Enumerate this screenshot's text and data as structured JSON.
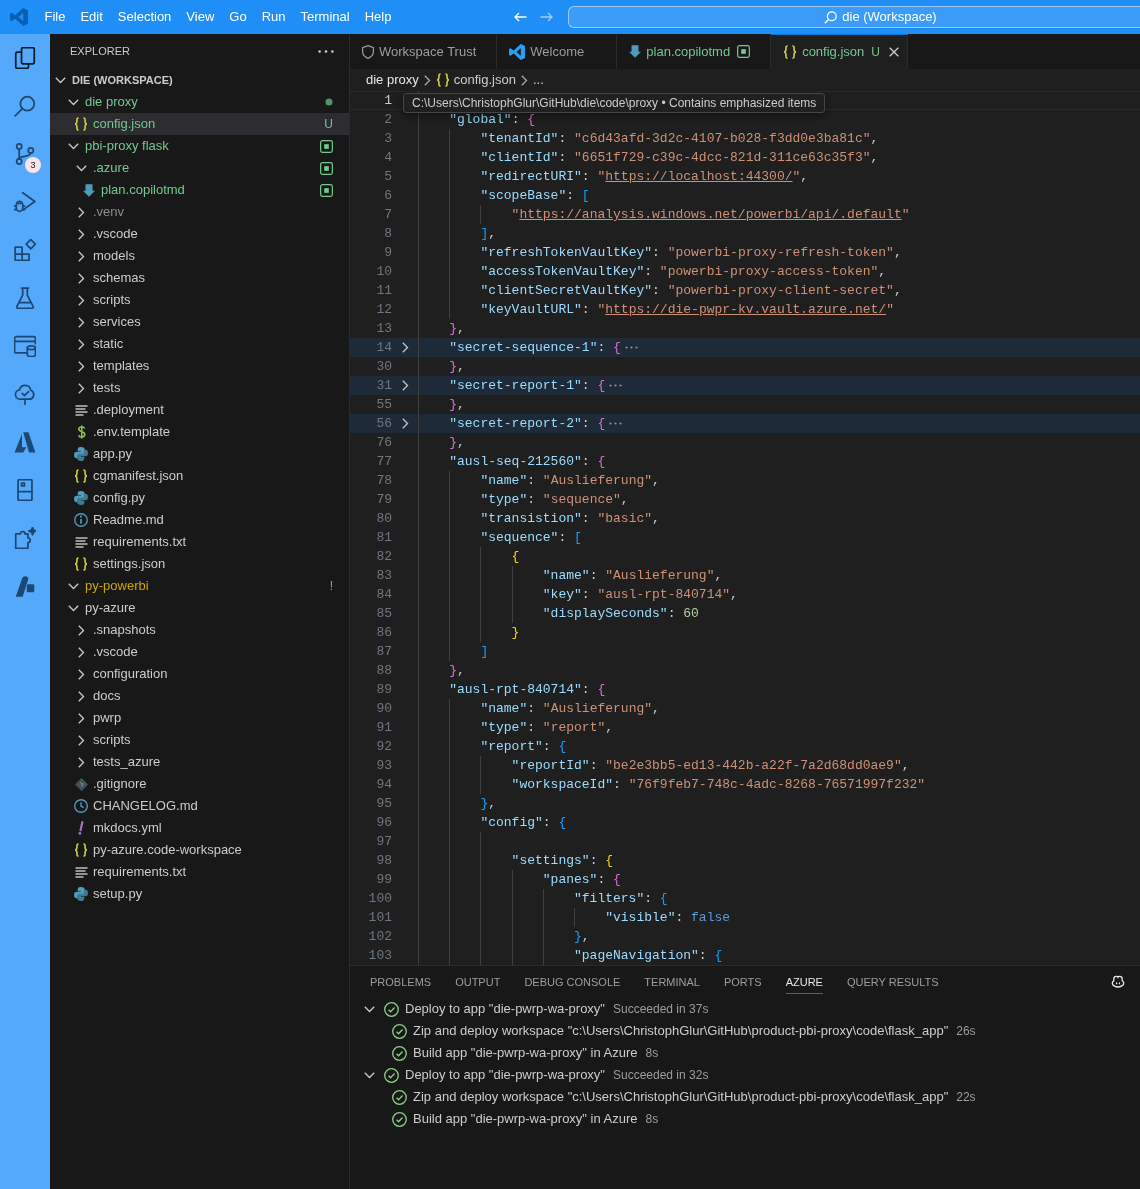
{
  "title_bar": {
    "menus": [
      "File",
      "Edit",
      "Selection",
      "View",
      "Go",
      "Run",
      "Terminal",
      "Help"
    ],
    "navigation": [
      {
        "kind": "back",
        "disabled": false
      },
      {
        "kind": "forward",
        "disabled": true
      }
    ],
    "search": "die (Workspace)"
  },
  "activity_bar": [
    {
      "kind": "files",
      "selected": true
    },
    {
      "kind": "search",
      "selected": false
    },
    {
      "kind": "branch",
      "selected": false,
      "badge": "3"
    },
    {
      "kind": "debug",
      "selected": false
    },
    {
      "kind": "extensions",
      "selected": false
    },
    {
      "kind": "flask",
      "selected": false
    },
    {
      "kind": "database",
      "selected": false
    },
    {
      "kind": "tree",
      "selected": false
    },
    {
      "kind": "triangle",
      "selected": false
    },
    {
      "kind": "panel",
      "selected": false
    },
    {
      "kind": "puzzle",
      "selected": false
    },
    {
      "kind": "blade",
      "selected": false
    }
  ],
  "explorer": {
    "title": "EXPLORER",
    "root": {
      "label": "DIE (WORKSPACE)",
      "expanded": true,
      "children": [
        {
          "label": "die proxy",
          "kind": "folder",
          "expanded": true,
          "selected": false,
          "color": "#73c991",
          "decoration": {
            "kind": "dot"
          },
          "children": [
            {
              "label": "config.json",
              "kind": "json",
              "selected": true,
              "color": "#73c991",
              "decoration": {
                "kind": "letter",
                "text": "U"
              }
            }
          ]
        },
        {
          "label": "pbi-proxy flask",
          "kind": "folder",
          "expanded": true,
          "selected": false,
          "color": "#73c991",
          "decoration": {
            "kind": "square"
          },
          "children": [
            {
              "label": ".azure",
              "kind": "folder",
              "expanded": true,
              "selected": false,
              "color": "#73c991",
              "decoration": {
                "kind": "square"
              },
              "children": [
                {
                  "label": "plan.copilotmd",
                  "kind": "copilot",
                  "selected": false,
                  "color": "#73c991",
                  "decoration": {
                    "kind": "square"
                  }
                }
              ]
            },
            {
              "label": ".venv",
              "kind": "folder",
              "expanded": false,
              "selected": false,
              "color": "#8c8c8c"
            },
            {
              "label": ".vscode",
              "kind": "folder",
              "expanded": false,
              "selected": false
            },
            {
              "label": "models",
              "kind": "folder",
              "expanded": false,
              "selected": false
            },
            {
              "label": "schemas",
              "kind": "folder",
              "expanded": false,
              "selected": false
            },
            {
              "label": "scripts",
              "kind": "folder",
              "expanded": false,
              "selected": false
            },
            {
              "label": "services",
              "kind": "folder",
              "expanded": false,
              "selected": false
            },
            {
              "label": "static",
              "kind": "folder",
              "expanded": false,
              "selected": false
            },
            {
              "label": "templates",
              "kind": "folder",
              "expanded": false,
              "selected": false
            },
            {
              "label": "tests",
              "kind": "folder",
              "expanded": false,
              "selected": false
            },
            {
              "label": ".deployment",
              "kind": "text",
              "selected": false
            },
            {
              "label": ".env.template",
              "kind": "env",
              "selected": false
            },
            {
              "label": "app.py",
              "kind": "python",
              "selected": false
            },
            {
              "label": "cgmanifest.json",
              "kind": "json",
              "selected": false
            },
            {
              "label": "config.py",
              "kind": "python",
              "selected": false
            },
            {
              "label": "Readme.md",
              "kind": "info",
              "selected": false
            },
            {
              "label": "requirements.txt",
              "kind": "text",
              "selected": false
            },
            {
              "label": "settings.json",
              "kind": "json",
              "selected": false
            }
          ]
        },
        {
          "label": "py-powerbi",
          "kind": "folder",
          "expanded": true,
          "selected": false,
          "color": "#cca700",
          "decoration": {
            "kind": "letter",
            "text": "!"
          }
        },
        {
          "label": "py-azure",
          "kind": "folder",
          "expanded": true,
          "selected": false,
          "children": [
            {
              "label": ".snapshots",
              "kind": "folder",
              "expanded": false,
              "selected": false
            },
            {
              "label": ".vscode",
              "kind": "folder",
              "expanded": false,
              "selected": false
            },
            {
              "label": "configuration",
              "kind": "folder",
              "expanded": false,
              "selected": false
            },
            {
              "label": "docs",
              "kind": "folder",
              "expanded": false,
              "selected": false
            },
            {
              "label": "pwrp",
              "kind": "folder",
              "expanded": false,
              "selected": false
            },
            {
              "label": "scripts",
              "kind": "folder",
              "expanded": false,
              "selected": false
            },
            {
              "label": "tests_azure",
              "kind": "folder",
              "expanded": false,
              "selected": false
            },
            {
              "label": ".gitignore",
              "kind": "git",
              "selected": false
            },
            {
              "label": "CHANGELOG.md",
              "kind": "changelog",
              "selected": false
            },
            {
              "label": "mkdocs.yml",
              "kind": "yaml",
              "selected": false
            },
            {
              "label": "py-azure.code-workspace",
              "kind": "json",
              "selected": false
            },
            {
              "label": "requirements.txt",
              "kind": "text",
              "selected": false
            },
            {
              "label": "setup.py",
              "kind": "python",
              "selected": false
            }
          ]
        }
      ]
    }
  },
  "tabs": [
    {
      "label": "Workspace Trust",
      "kind": "trust",
      "selected": false
    },
    {
      "label": "Welcome",
      "kind": "welcome",
      "selected": false
    },
    {
      "label": "plan.copilotmd",
      "kind": "copilot",
      "selected": false,
      "color": "#73c991",
      "decoration": {
        "kind": "square"
      }
    },
    {
      "label": "config.json",
      "kind": "json",
      "selected": true,
      "color": "#73c991",
      "decoration": {
        "kind": "letter",
        "text": "U"
      }
    }
  ],
  "breadcrumb": [
    {
      "label": "die proxy",
      "kind": "folder"
    },
    {
      "label": "config.json",
      "kind": "json"
    },
    {
      "label": "...",
      "kind": "symbols"
    }
  ],
  "tooltip": "C:\\Users\\ChristophGlur\\GitHub\\die\\code\\proxy • Contains emphasized items",
  "code_lines": [
    {
      "number": "1",
      "current": true,
      "folded": false
    },
    {
      "number": "2",
      "current": false,
      "folded": false,
      "text": "    \"global\": {"
    },
    {
      "number": "3",
      "current": false,
      "folded": false,
      "text": "        \"tenantId\": \"c6d43afd-3d2c-4107-b028-f3dd0e3ba81c\","
    },
    {
      "number": "4",
      "current": false,
      "folded": false,
      "text": "        \"clientId\": \"6651f729-c39c-4dcc-821d-311ce63c35f3\","
    },
    {
      "number": "5",
      "current": false,
      "folded": false,
      "text": "        \"redirectURI\": \"https://localhost:44300/\","
    },
    {
      "number": "6",
      "current": false,
      "folded": false,
      "text": "        \"scopeBase\": ["
    },
    {
      "number": "7",
      "current": false,
      "folded": false,
      "text": "            \"https://analysis.windows.net/powerbi/api/.default\""
    },
    {
      "number": "8",
      "current": false,
      "folded": false,
      "text": "        ],"
    },
    {
      "number": "9",
      "current": false,
      "folded": false,
      "text": "        \"refreshTokenVaultKey\": \"powerbi-proxy-refresh-token\","
    },
    {
      "number": "10",
      "current": false,
      "folded": false,
      "text": "        \"accessTokenVaultKey\": \"powerbi-proxy-access-token\","
    },
    {
      "number": "11",
      "current": false,
      "folded": false,
      "text": "        \"clientSecretVaultKey\": \"powerbi-proxy-client-secret\","
    },
    {
      "number": "12",
      "current": false,
      "folded": false,
      "text": "        \"keyVaultURL\": \"https://die-pwpr-kv.vault.azure.net/\""
    },
    {
      "number": "13",
      "current": false,
      "folded": false,
      "text": "    },"
    },
    {
      "number": "14",
      "current": false,
      "folded": true,
      "text": "    \"secret-sequence-1\": {"
    },
    {
      "number": "30",
      "current": false,
      "folded": false,
      "text": "    },"
    },
    {
      "number": "31",
      "current": false,
      "folded": true,
      "text": "    \"secret-report-1\": {"
    },
    {
      "number": "55",
      "current": false,
      "folded": false,
      "text": "    },"
    },
    {
      "number": "56",
      "current": false,
      "folded": true,
      "text": "    \"secret-report-2\": {"
    },
    {
      "number": "76",
      "current": false,
      "folded": false,
      "text": "    },"
    },
    {
      "number": "77",
      "current": false,
      "folded": false,
      "text": "    \"ausl-seq-212560\": {"
    },
    {
      "number": "78",
      "current": false,
      "folded": false,
      "text": "        \"name\": \"Auslieferung\","
    },
    {
      "number": "79",
      "current": false,
      "folded": false,
      "text": "        \"type\": \"sequence\","
    },
    {
      "number": "80",
      "current": false,
      "folded": false,
      "text": "        \"transistion\": \"basic\","
    },
    {
      "number": "81",
      "current": false,
      "folded": false,
      "text": "        \"sequence\": ["
    },
    {
      "number": "82",
      "current": false,
      "folded": false,
      "text": "            {"
    },
    {
      "number": "83",
      "current": false,
      "folded": false,
      "text": "                \"name\": \"Auslieferung\","
    },
    {
      "number": "84",
      "current": false,
      "folded": false,
      "text": "                \"key\": \"ausl-rpt-840714\","
    },
    {
      "number": "85",
      "current": false,
      "folded": false,
      "text": "                \"displaySeconds\": 60"
    },
    {
      "number": "86",
      "current": false,
      "folded": false,
      "text": "            }"
    },
    {
      "number": "87",
      "current": false,
      "folded": false,
      "text": "        ]"
    },
    {
      "number": "88",
      "current": false,
      "folded": false,
      "text": "    },"
    },
    {
      "number": "89",
      "current": false,
      "folded": false,
      "text": "    \"ausl-rpt-840714\": {"
    },
    {
      "number": "90",
      "current": false,
      "folded": false,
      "text": "        \"name\": \"Auslieferung\","
    },
    {
      "number": "91",
      "current": false,
      "folded": false,
      "text": "        \"type\": \"report\","
    },
    {
      "number": "92",
      "current": false,
      "folded": false,
      "text": "        \"report\": {"
    },
    {
      "number": "93",
      "current": false,
      "folded": false,
      "text": "            \"reportId\": \"be2e3bb5-ed13-442b-a22f-7a2d68dd0ae9\","
    },
    {
      "number": "94",
      "current": false,
      "folded": false,
      "text": "            \"workspaceId\": \"76f9feb7-748c-4adc-8268-76571997f232\""
    },
    {
      "number": "95",
      "current": false,
      "folded": false,
      "text": "        },"
    },
    {
      "number": "96",
      "current": false,
      "folded": false,
      "text": "        \"config\": {"
    },
    {
      "number": "97",
      "current": false,
      "folded": false
    },
    {
      "number": "98",
      "current": false,
      "folded": false,
      "text": "            \"settings\": {"
    },
    {
      "number": "99",
      "current": false,
      "folded": false,
      "text": "                \"panes\": {"
    },
    {
      "number": "100",
      "current": false,
      "folded": false,
      "text": "                    \"filters\": {"
    },
    {
      "number": "101",
      "current": false,
      "folded": false,
      "text": "                        \"visible\": false"
    },
    {
      "number": "102",
      "current": false,
      "folded": false,
      "text": "                    },"
    },
    {
      "number": "103",
      "current": false,
      "folded": false,
      "text": "                    \"pageNavigation\": {"
    }
  ],
  "panel": {
    "tabs": [
      {
        "label": "PROBLEMS",
        "selected": false
      },
      {
        "label": "OUTPUT",
        "selected": false
      },
      {
        "label": "DEBUG CONSOLE",
        "selected": false
      },
      {
        "label": "TERMINAL",
        "selected": false
      },
      {
        "label": "PORTS",
        "selected": false
      },
      {
        "label": "AZURE",
        "selected": true
      },
      {
        "label": "QUERY RESULTS",
        "selected": false
      }
    ],
    "tasks": [
      {
        "label": "Deploy to app \"die-pwrp-wa-proxy\"",
        "detail": "Succeeded in 37s",
        "kind": "success",
        "expanded": true,
        "children": [
          {
            "label": "Zip and deploy workspace \"c:\\Users\\ChristophGlur\\GitHub\\product-pbi-proxy\\code\\flask_app\"",
            "detail": "26s",
            "kind": "success"
          },
          {
            "label": "Build app \"die-pwrp-wa-proxy\" in Azure",
            "detail": "8s",
            "kind": "success"
          }
        ]
      },
      {
        "label": "Deploy to app \"die-pwrp-wa-proxy\"",
        "detail": "Succeeded in 32s",
        "kind": "success",
        "expanded": true,
        "children": [
          {
            "label": "Zip and deploy workspace \"c:\\Users\\ChristophGlur\\GitHub\\product-pbi-proxy\\code\\flask_app\"",
            "detail": "22s",
            "kind": "success"
          },
          {
            "label": "Build app \"die-pwrp-wa-proxy\" in Azure",
            "detail": "8s",
            "kind": "success"
          }
        ]
      }
    ]
  }
}
